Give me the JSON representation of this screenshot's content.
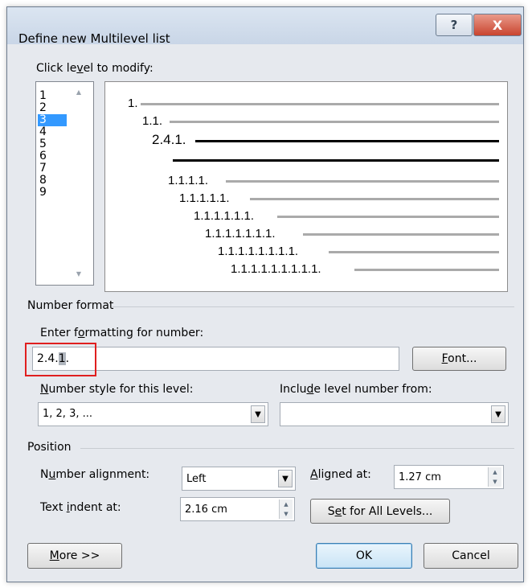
{
  "window": {
    "title": "Define new Multilevel list",
    "help_label": "?",
    "close_label": "X"
  },
  "levels": {
    "label_pre": "Click le",
    "label_u": "v",
    "label_post": "el to modify:",
    "items": [
      "1",
      "2",
      "3",
      "4",
      "5",
      "6",
      "7",
      "8",
      "9"
    ],
    "selected": "3"
  },
  "preview": {
    "lines": [
      "1.",
      "1.1.",
      "2.4.1.",
      "1.1.1.1.",
      "1.1.1.1.1.",
      "1.1.1.1.1.1.",
      "1.1.1.1.1.1.1.",
      "1.1.1.1.1.1.1.1.",
      "1.1.1.1.1.1.1.1.1."
    ]
  },
  "number_format": {
    "section": "Number format",
    "enter_pre": "Enter f",
    "enter_u": "o",
    "enter_post": "rmatting for number:",
    "value_pre": "2.4.",
    "value_sel": "1",
    "value_post": ".",
    "font_u": "F",
    "font_post": "ont...",
    "style_u": "N",
    "style_post": "umber style for this level:",
    "style_value": "1, 2, 3, ...",
    "include_pre": "Inclu",
    "include_u": "d",
    "include_post": "e level number from:",
    "include_value": ""
  },
  "position": {
    "section": "Position",
    "align_pre": "N",
    "align_u": "u",
    "align_post": "mber alignment:",
    "align_value": "Left",
    "aligned_u": "A",
    "aligned_post": "ligned at:",
    "aligned_value": "1.27 cm",
    "indent_pre": "Text ",
    "indent_u": "i",
    "indent_post": "ndent at:",
    "indent_value": "2.16 cm",
    "setall_pre": "S",
    "setall_u": "e",
    "setall_post": "t for All Levels..."
  },
  "footer": {
    "more_u": "M",
    "more_post": "ore >>",
    "ok": "OK",
    "cancel": "Cancel"
  },
  "colors": {
    "selection": "#3399ff",
    "highlight_box": "#e01f1f",
    "close": "#c9442f"
  }
}
